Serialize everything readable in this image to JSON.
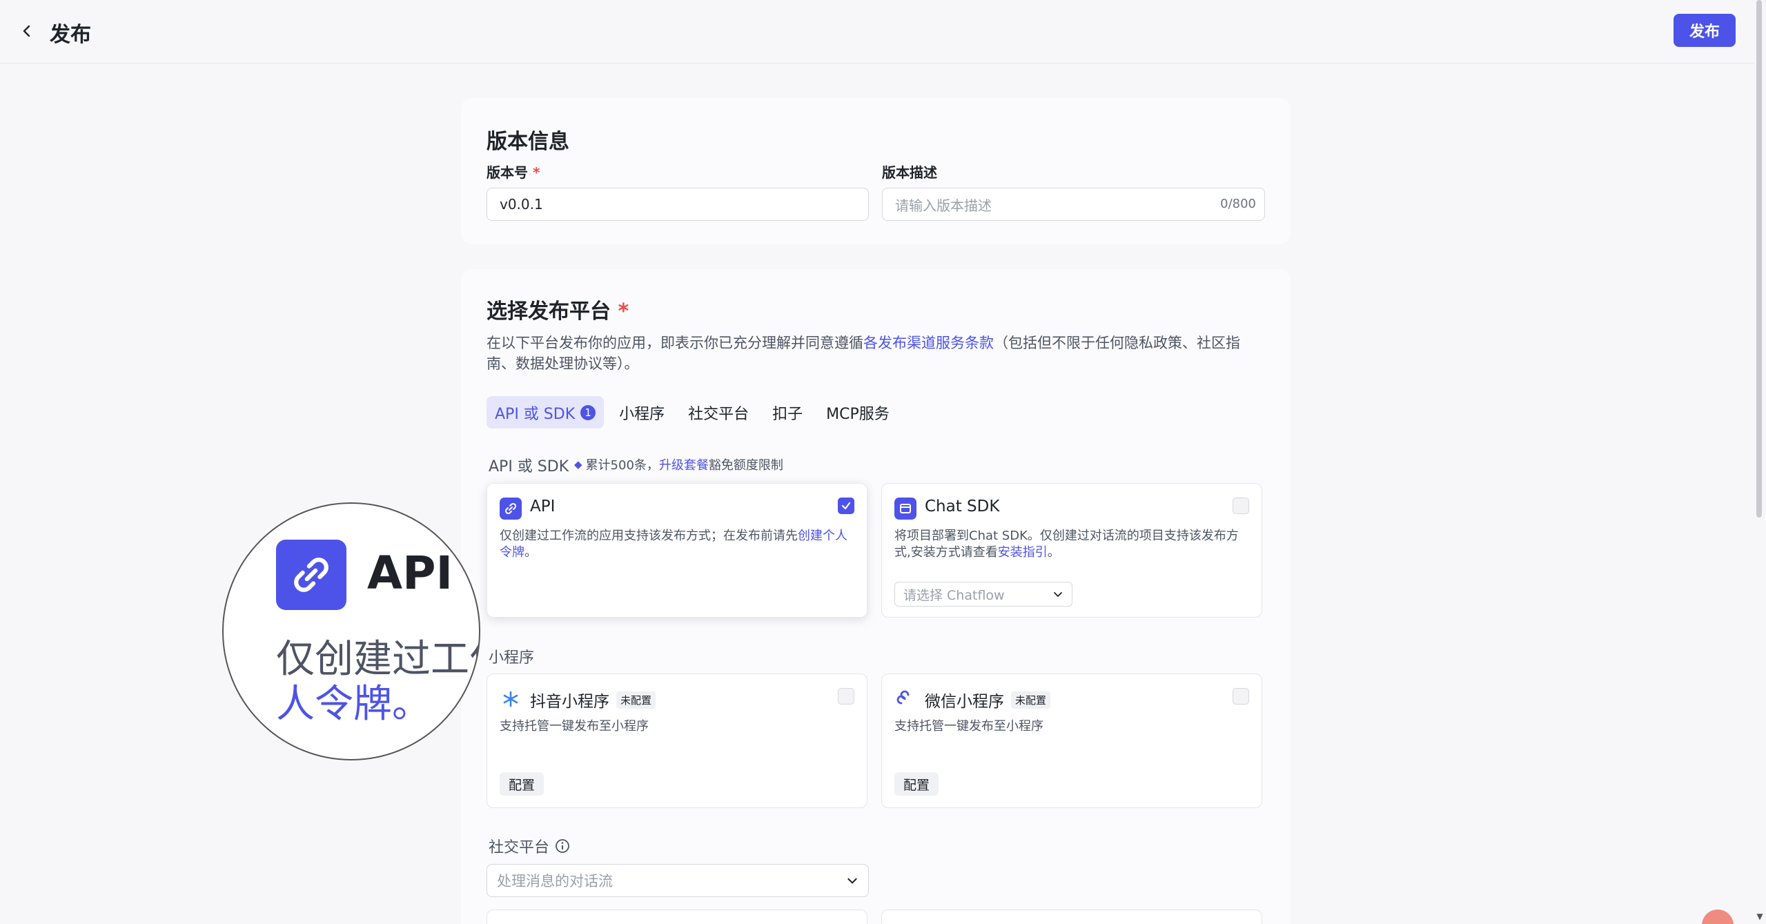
{
  "header": {
    "back_icon": "chevron-left-icon",
    "title": "发布",
    "publish_label": "发布",
    "accent": "#4d53e8"
  },
  "version_card": {
    "title": "版本信息",
    "version_label": "版本号",
    "required_mark": "*",
    "version_value": "v0.0.1",
    "desc_label": "版本描述",
    "desc_placeholder": "请输入版本描述",
    "desc_counter": "0/800"
  },
  "platform_card": {
    "title": "选择发布平台",
    "required_mark": "*",
    "desc_prefix": "在以下平台发布你的应用，即表示你已充分理解并同意遵循",
    "desc_link": "各发布渠道服务条款",
    "desc_suffix": "（包括但不限于任何隐私政策、社区指南、数据处理协议等）。",
    "tabs": [
      {
        "label": "API 或 SDK",
        "badge": "1"
      },
      {
        "label": "小程序"
      },
      {
        "label": "社交平台"
      },
      {
        "label": "扣子"
      },
      {
        "label": "MCP服务"
      }
    ],
    "api_section": {
      "title": "API 或 SDK",
      "quota_prefix": "累计500条，",
      "quota_link": "升级套餐",
      "quota_suffix": "豁免额度限制"
    },
    "api_card": {
      "title": "API",
      "desc": "仅创建过工作流的应用支持该发布方式；在发布前请先",
      "link": "创建个人令牌",
      "desc_end": "。",
      "checked": true
    },
    "chat_sdk_card": {
      "title": "Chat SDK",
      "desc": "将项目部署到Chat SDK。仅创建过对话流的项目支持该发布方式,安装方式请查看",
      "link": "安装指引",
      "desc_end": "。",
      "select_placeholder": "请选择 Chatflow",
      "checked": false
    },
    "mini_section": {
      "title": "小程序"
    },
    "douyin_card": {
      "title": "抖音小程序",
      "tag": "未配置",
      "desc": "支持托管一键发布至小程序",
      "button": "配置"
    },
    "wechat_card": {
      "title": "微信小程序",
      "tag": "未配置",
      "desc": "支持托管一键发布至小程序",
      "button": "配置"
    },
    "social_section": {
      "title": "社交平台",
      "select_placeholder": "处理消息的对话流"
    }
  },
  "magnifier": {
    "title": "API",
    "line1": "仅创建过工作",
    "line2": "人令牌。"
  }
}
